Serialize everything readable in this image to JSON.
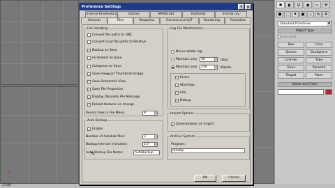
{
  "viewports": {
    "top_left_label": "",
    "bottom_left_label": "",
    "axis_x": "x",
    "axis_y": "y",
    "axis_z": "z",
    "status": "1:100"
  },
  "command_panel": {
    "tab_icons": [
      "create-tab",
      "modify-tab",
      "hierarchy-tab",
      "motion-tab",
      "display-tab",
      "utilities-tab"
    ],
    "category_icons": [
      "geometry-icon",
      "shapes-icon",
      "lights-icon",
      "cameras-icon",
      "helpers-icon",
      "spacewarps-icon",
      "systems-icon"
    ],
    "dropdown": "Standard Primitives",
    "object_type_header": "Object Type",
    "autogrid": "AutoGrid",
    "object_buttons": [
      "Box",
      "Cone",
      "Sphere",
      "GeoSphere",
      "Cylinder",
      "Tube",
      "Torus",
      "Pyramid",
      "Teapot",
      "Plane"
    ],
    "name_color_header": "Name and Color",
    "swatch_color": "#c0202a"
  },
  "dialog": {
    "title": "Preference Settings",
    "tabs_top": [
      "Inverse Kinematics",
      "Gizmos",
      "MAXScript",
      "Radiosity",
      "mental ray"
    ],
    "tabs_bottom": [
      "General",
      "Files",
      "Viewports",
      "Gamma and LUT",
      "Rendering",
      "Animation"
    ],
    "active_tab": "Files",
    "file_handling": {
      "legend": "File Handling",
      "options": [
        {
          "label": "Convert file paths to UNC",
          "checked": false
        },
        {
          "label": "Convert local file paths to Relative",
          "checked": false
        },
        {
          "label": "Backup on Save",
          "checked": true
        },
        {
          "label": "Increment on Save",
          "checked": false
        },
        {
          "label": "Compress on Save",
          "checked": false
        },
        {
          "label": "Save Viewport Thumbnail Image",
          "checked": true
        },
        {
          "label": "Save Schematic View",
          "checked": true
        },
        {
          "label": "Save File Properties",
          "checked": true
        },
        {
          "label": "Display Obsolete File Message",
          "checked": true
        },
        {
          "label": "Reload textures on change",
          "checked": true
        }
      ],
      "recent_label": "Recent Files in File Menu:",
      "recent_value": "9"
    },
    "auto_backup": {
      "legend": "Auto Backup",
      "enable_label": "Enable",
      "enable_checked": true,
      "num_files_label": "Number of Autobak files:",
      "num_files_value": "3",
      "interval_label": "Backup Interval (minutes):",
      "interval_value": "5.0",
      "file_name_label": "Auto Backup File Name:",
      "file_name_value": "AutoBackup"
    },
    "log_file": {
      "legend": "Log File Maintenance",
      "never_label": "Never delete log",
      "maintain_days_label": "Maintain only",
      "maintain_days_value": "30",
      "days_unit": "days",
      "maintain_size_label": "Maintain only",
      "maintain_size_value": "256",
      "size_unit": "KBytes",
      "levels": [
        {
          "label": "Errors",
          "checked": true
        },
        {
          "label": "Warnings",
          "checked": true
        },
        {
          "label": "Info",
          "checked": true
        },
        {
          "label": "Debug",
          "checked": true
        }
      ]
    },
    "import_options": {
      "legend": "Import Options",
      "zoom_label": "Zoom Extents on Import",
      "zoom_checked": true
    },
    "archive": {
      "legend": "Archive System",
      "program_label": "Program:",
      "program_value": "maxzip"
    },
    "buttons": {
      "ok": "OK",
      "cancel": "Cancel"
    }
  }
}
